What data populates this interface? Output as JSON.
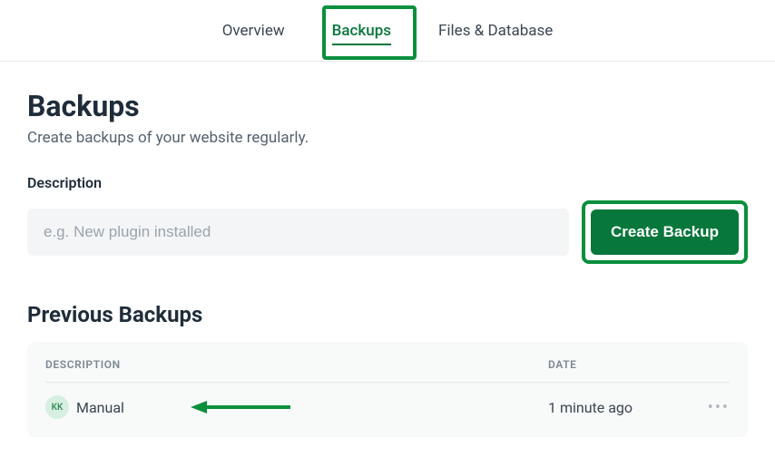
{
  "tabs": [
    {
      "label": "Overview"
    },
    {
      "label": "Backups"
    },
    {
      "label": "Files & Database"
    }
  ],
  "page": {
    "title": "Backups",
    "subtitle": "Create backups of your website regularly."
  },
  "form": {
    "desc_label": "Description",
    "placeholder": "e.g. New plugin installed",
    "create_label": "Create Backup"
  },
  "previous": {
    "title": "Previous Backups",
    "columns": {
      "desc": "DESCRIPTION",
      "date": "DATE"
    },
    "rows": [
      {
        "avatar": "KK",
        "description": "Manual",
        "date": "1 minute ago"
      }
    ]
  }
}
